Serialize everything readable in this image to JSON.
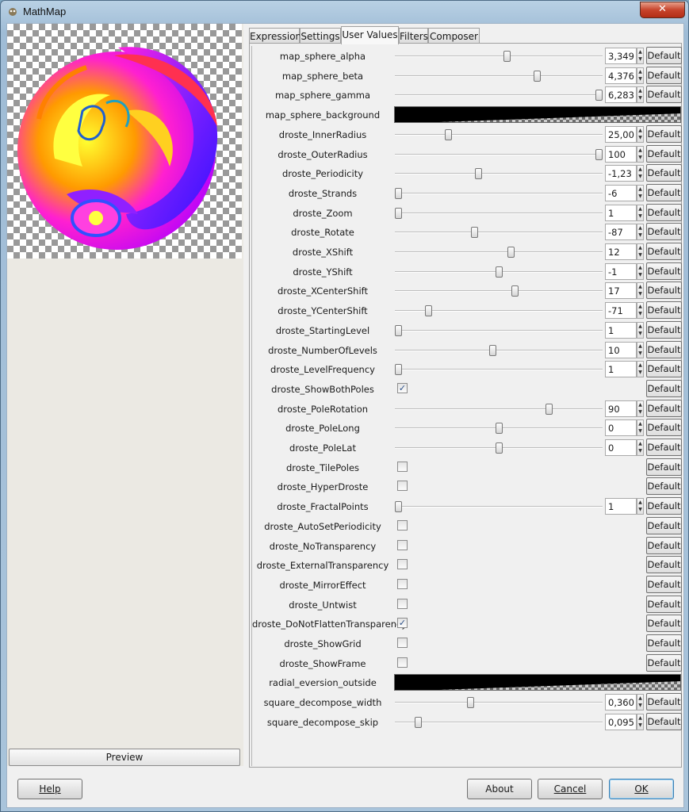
{
  "window": {
    "title": "MathMap",
    "close_glyph": "✕"
  },
  "tabs": [
    {
      "label": "Expression"
    },
    {
      "label": "Settings"
    },
    {
      "label": "User Values"
    },
    {
      "label": "Filters"
    },
    {
      "label": "Composer"
    }
  ],
  "preview": {
    "button_label": "Preview"
  },
  "params": [
    {
      "label": "map_sphere_alpha",
      "type": "slider",
      "value": "3,349",
      "level": 0.54,
      "button": "Default"
    },
    {
      "label": "map_sphere_beta",
      "type": "slider",
      "value": "4,376",
      "level": 0.69,
      "button": "Default"
    },
    {
      "label": "map_sphere_gamma",
      "type": "slider",
      "value": "6,283",
      "level": 1.0,
      "button": "Default"
    },
    {
      "label": "map_sphere_background",
      "type": "gradient"
    },
    {
      "label": "droste_InnerRadius",
      "type": "slider",
      "value": "25,00",
      "level": 0.25,
      "button": "Default"
    },
    {
      "label": "droste_OuterRadius",
      "type": "slider",
      "value": "100",
      "level": 1.0,
      "button": "Default"
    },
    {
      "label": "droste_Periodicity",
      "type": "slider",
      "value": "-1,23",
      "level": 0.4,
      "button": "Default"
    },
    {
      "label": "droste_Strands",
      "type": "slider",
      "value": "-6",
      "level": 0.0,
      "button": "Default"
    },
    {
      "label": "droste_Zoom",
      "type": "slider",
      "value": "1",
      "level": 0.0,
      "button": "Default"
    },
    {
      "label": "droste_Rotate",
      "type": "slider",
      "value": "-87",
      "level": 0.38,
      "button": "Default"
    },
    {
      "label": "droste_XShift",
      "type": "slider",
      "value": "12",
      "level": 0.56,
      "button": "Default"
    },
    {
      "label": "droste_YShift",
      "type": "slider",
      "value": "-1",
      "level": 0.5,
      "button": "Default"
    },
    {
      "label": "droste_XCenterShift",
      "type": "slider",
      "value": "17",
      "level": 0.58,
      "button": "Default"
    },
    {
      "label": "droste_YCenterShift",
      "type": "slider",
      "value": "-71",
      "level": 0.15,
      "button": "Default"
    },
    {
      "label": "droste_StartingLevel",
      "type": "slider",
      "value": "1",
      "level": 0.0,
      "button": "Default"
    },
    {
      "label": "droste_NumberOfLevels",
      "type": "slider",
      "value": "10",
      "level": 0.47,
      "button": "Default"
    },
    {
      "label": "droste_LevelFrequency",
      "type": "slider",
      "value": "1",
      "level": 0.0,
      "button": "Default"
    },
    {
      "label": "droste_ShowBothPoles",
      "type": "check",
      "checked": true,
      "button": "Default"
    },
    {
      "label": "droste_PoleRotation",
      "type": "slider",
      "value": "90",
      "level": 0.75,
      "button": "Default"
    },
    {
      "label": "droste_PoleLong",
      "type": "slider",
      "value": "0",
      "level": 0.5,
      "button": "Default"
    },
    {
      "label": "droste_PoleLat",
      "type": "slider",
      "value": "0",
      "level": 0.5,
      "button": "Default"
    },
    {
      "label": "droste_TilePoles",
      "type": "check",
      "checked": false,
      "button": "Default"
    },
    {
      "label": "droste_HyperDroste",
      "type": "check",
      "checked": false,
      "button": "Default"
    },
    {
      "label": "droste_FractalPoints",
      "type": "slider",
      "value": "1",
      "level": 0.0,
      "button": "Default"
    },
    {
      "label": "droste_AutoSetPeriodicity",
      "type": "check",
      "checked": false,
      "button": "Default"
    },
    {
      "label": "droste_NoTransparency",
      "type": "check",
      "checked": false,
      "button": "Default"
    },
    {
      "label": "droste_ExternalTransparency",
      "type": "check",
      "checked": false,
      "button": "Default"
    },
    {
      "label": "droste_MirrorEffect",
      "type": "check",
      "checked": false,
      "button": "Default"
    },
    {
      "label": "droste_Untwist",
      "type": "check",
      "checked": false,
      "button": "Default"
    },
    {
      "label": "droste_DoNotFlattenTransparency",
      "type": "check",
      "checked": true,
      "button": "Default"
    },
    {
      "label": "droste_ShowGrid",
      "type": "check",
      "checked": false,
      "button": "Default"
    },
    {
      "label": "droste_ShowFrame",
      "type": "check",
      "checked": false,
      "button": "Default"
    },
    {
      "label": "radial_eversion_outside",
      "type": "gradient"
    },
    {
      "label": "square_decompose_width",
      "type": "slider",
      "value": "0,360",
      "level": 0.36,
      "button": "Default"
    },
    {
      "label": "square_decompose_skip",
      "type": "slider",
      "value": "0,095",
      "level": 0.1,
      "button": "Default"
    }
  ],
  "footer": {
    "help_label": "Help",
    "about_label": "About",
    "cancel_label": "Cancel",
    "ok_label": "OK"
  },
  "colors": {
    "check_mark": "#2b4f87",
    "close_button": "#c7442c"
  }
}
